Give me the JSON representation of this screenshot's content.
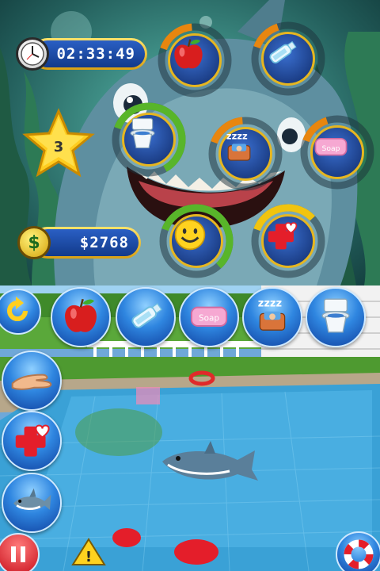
{
  "hud": {
    "timer": "02:33:49",
    "level": "3",
    "money": "$2768"
  },
  "needs": [
    {
      "name": "food",
      "icon": "apple-icon",
      "level": 0.25
    },
    {
      "name": "water",
      "icon": "water-bottle-icon",
      "level": 0.2
    },
    {
      "name": "toilet",
      "icon": "toilet-icon",
      "level": 0.85
    },
    {
      "name": "sleep",
      "icon": "sleep-icon",
      "level": 0.25
    },
    {
      "name": "clean",
      "icon": "soap-icon",
      "level": 0.2
    },
    {
      "name": "happiness",
      "icon": "smiley-icon",
      "level": 0.8
    },
    {
      "name": "health",
      "icon": "health-icon",
      "level": 0.45
    }
  ],
  "soap_label": "Soap",
  "toolbar": {
    "items": [
      "apple-icon",
      "water-bottle-icon",
      "soap-icon",
      "sleep-icon",
      "toilet-icon"
    ]
  },
  "side_menu": [
    "pet-hand-icon",
    "health-icon",
    "shark-icon"
  ],
  "colors": {
    "gauge_low": "#e8860f",
    "gauge_mid": "#f1c40f",
    "gauge_high": "#58b52a",
    "button_blue": "#2f86e0",
    "pill_gold": "#e6b620"
  }
}
